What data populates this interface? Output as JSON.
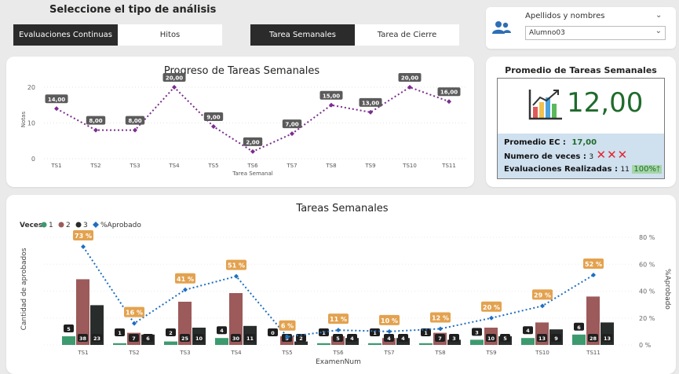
{
  "header": {
    "title": "Seleccione el tipo de análisis",
    "toggle1": {
      "on": "Evaluaciones Continuas",
      "off": "Hitos"
    },
    "toggle2": {
      "on": "Tarea Semanales",
      "off": "Tarea de Cierre"
    }
  },
  "filter": {
    "label": "Apellidos y nombres",
    "value": "Alumno03"
  },
  "kpi": {
    "title": "Promedio de Tareas Semanales",
    "value": "12,00",
    "promedio_label": "Promedio EC :",
    "promedio_value": "17,00",
    "veces_label": "Numero de veces :",
    "veces_value": "3",
    "eval_label": "Evaluaciones Realizadas :",
    "eval_value": "11",
    "pct_value": "100%",
    "colors": {
      "value": "#1f6b2b",
      "x": "#e0262e",
      "pct_bg": "#a5d6a7"
    }
  },
  "chart_data": [
    {
      "type": "line",
      "title": "Progreso de Tareas Semanales",
      "xlabel": "Tarea Semanal",
      "ylabel": "Notas",
      "ylim": [
        0,
        20
      ],
      "yticks": [
        0,
        10,
        20
      ],
      "categories": [
        "TS1",
        "TS2",
        "TS3",
        "TS4",
        "TS5",
        "TS6",
        "TS7",
        "TS8",
        "TS9",
        "TS10",
        "TS11"
      ],
      "values": [
        14,
        8,
        8,
        20,
        9,
        2,
        7,
        15,
        13,
        20,
        16
      ],
      "data_labels": [
        "14,00",
        "8,00",
        "8,00",
        "20,00",
        "9,00",
        "2,00",
        "7,00",
        "15,00",
        "13,00",
        "20,00",
        "16,00"
      ],
      "color": "#7b2d8e"
    },
    {
      "type": "bar",
      "title": "Tareas Semanales",
      "legend_title": "Veces",
      "xlabel": "ExamenNum",
      "ylabel": "Cantidad de aprobados",
      "y2label": "%Aprobado",
      "y2ticks": [
        "0 %",
        "20 %",
        "40 %",
        "60 %",
        "80 %"
      ],
      "categories": [
        "TS1",
        "TS2",
        "TS3",
        "TS4",
        "TS5",
        "TS6",
        "TS7",
        "TS8",
        "TS9",
        "TS10",
        "TS11"
      ],
      "series": [
        {
          "name": "1",
          "color": "#3d9a6f",
          "values": [
            5,
            1,
            2,
            4,
            0,
            1,
            1,
            1,
            3,
            4,
            6
          ]
        },
        {
          "name": "2",
          "color": "#9c5a5a",
          "values": [
            38,
            7,
            25,
            30,
            5,
            5,
            4,
            7,
            10,
            13,
            28
          ]
        },
        {
          "name": "3",
          "color": "#282d2b",
          "values": [
            23,
            6,
            10,
            11,
            2,
            4,
            4,
            3,
            5,
            9,
            13
          ]
        }
      ],
      "line": {
        "name": "%Aprobado",
        "color": "#1f6fc0",
        "values": [
          73,
          16,
          41,
          51,
          6,
          11,
          10,
          12,
          20,
          29,
          52
        ],
        "labels": [
          "73 %",
          "16 %",
          "41 %",
          "51 %",
          "6 %",
          "11 %",
          "10 %",
          "12 %",
          "20 %",
          "29 %",
          "52 %"
        ]
      },
      "y2lim": [
        0,
        80
      ]
    }
  ]
}
